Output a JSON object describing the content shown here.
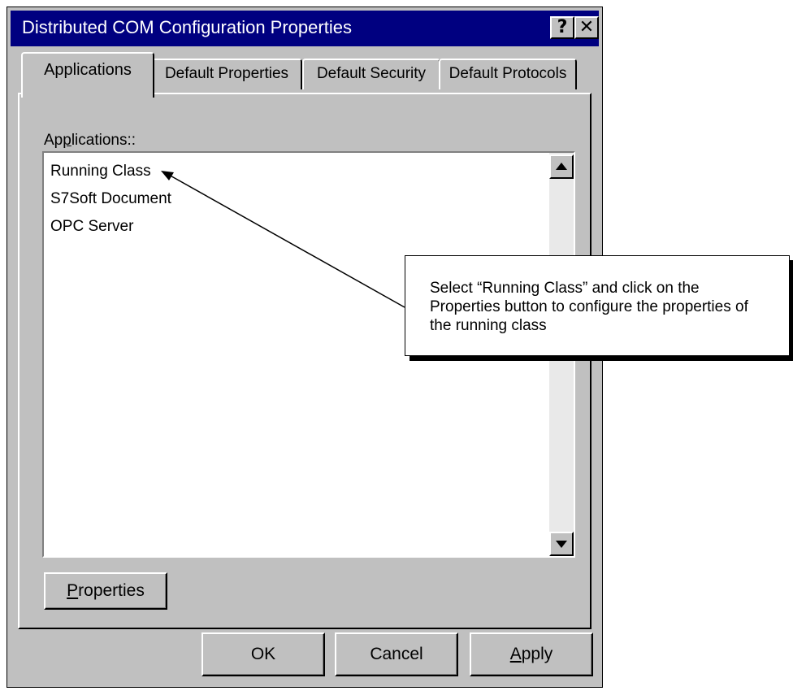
{
  "window": {
    "title": "Distributed COM Configuration Properties",
    "help_label": "?",
    "close_label": "✕"
  },
  "tabs": [
    {
      "label": "Applications",
      "active": true
    },
    {
      "label": "Default Properties",
      "active": false
    },
    {
      "label": "Default Security",
      "active": false
    },
    {
      "label": "Default Protocols",
      "active": false
    }
  ],
  "applications": {
    "label_prefix": "Ap",
    "label_mnemonic": "p",
    "label_suffix": "lications::",
    "items": [
      "Running Class",
      "S7Soft Document",
      "OPC Server"
    ]
  },
  "buttons": {
    "properties_mnemonic": "P",
    "properties_rest": "roperties",
    "ok": "OK",
    "cancel": "Cancel",
    "apply_mnemonic": "A",
    "apply_rest": "pply"
  },
  "callout": {
    "text": "Select “Running Class” and click on the Properties button to configure the properties of the running class"
  },
  "icons": {
    "scroll_up": "scroll-up-arrow-icon",
    "scroll_down": "scroll-down-arrow-icon"
  },
  "colors": {
    "titlebar": "#000080",
    "dialog_face": "#c0c0c0"
  }
}
